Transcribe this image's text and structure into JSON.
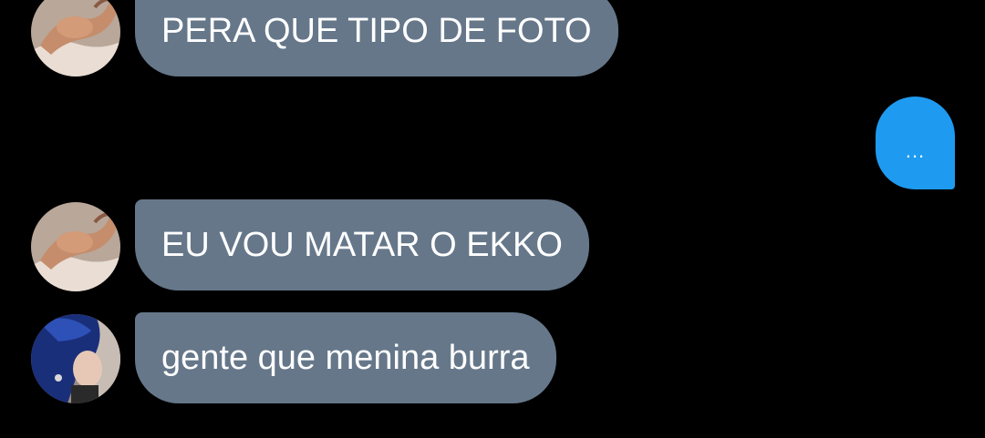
{
  "messages": [
    {
      "sender": "user-flex",
      "text": "PERA QUE TIPO DE FOTO",
      "direction": "incoming"
    },
    {
      "sender": "self",
      "text": "...",
      "direction": "outgoing",
      "state": "typing-indicator"
    },
    {
      "sender": "user-flex",
      "text": "EU VOU MATAR O EKKO",
      "direction": "incoming"
    },
    {
      "sender": "user-blue-hair",
      "text": "gente que menina burra",
      "direction": "incoming"
    }
  ],
  "colors": {
    "background": "#000000",
    "incoming_bubble": "#66778a",
    "outgoing_bubble": "#1e9bf0",
    "text": "#ffffff"
  }
}
